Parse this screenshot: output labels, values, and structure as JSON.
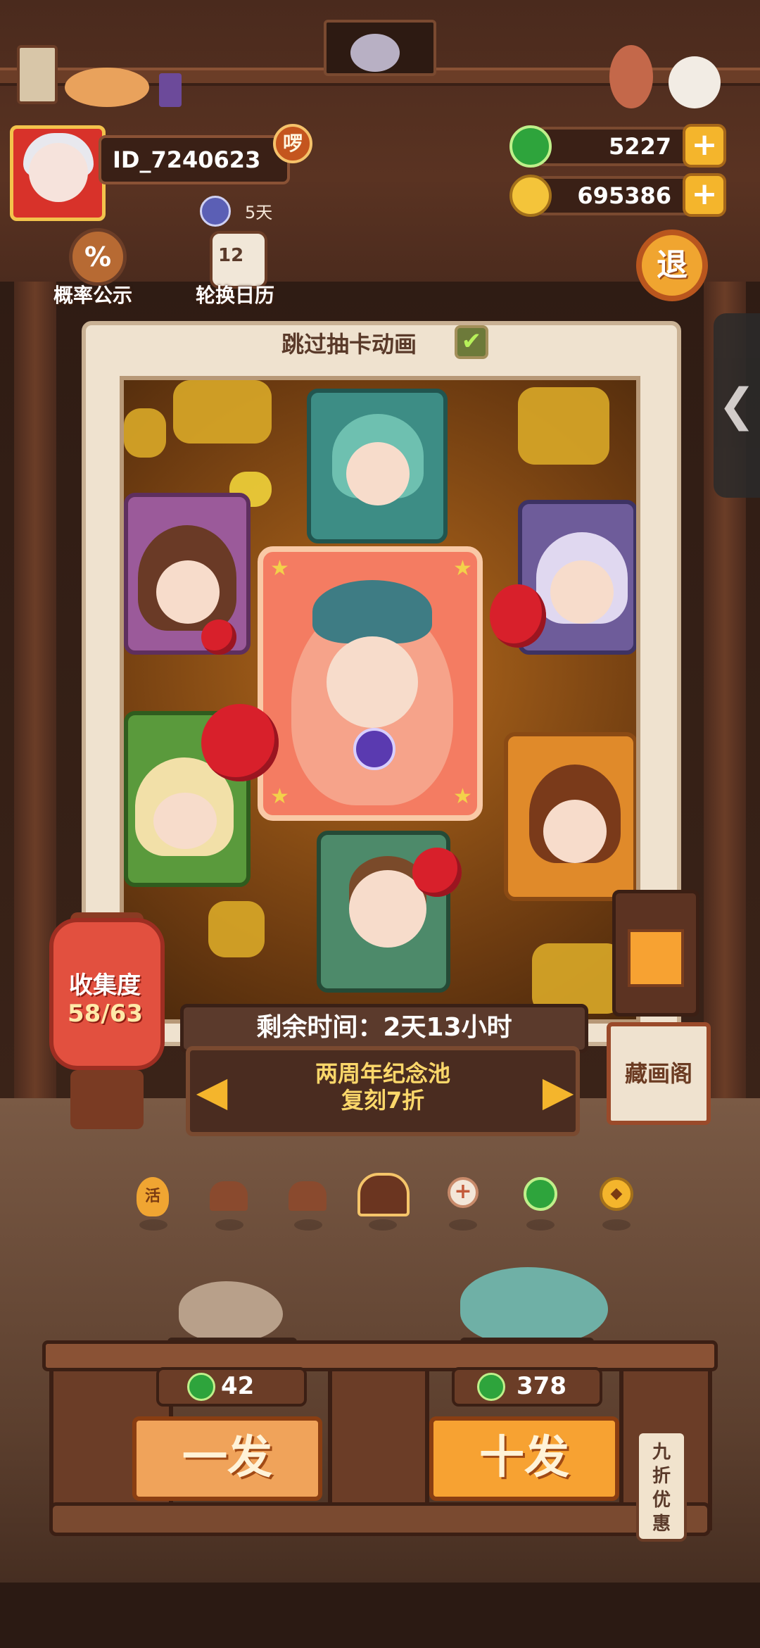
{
  "player": {
    "id": "ID_7240623",
    "badge": "啰",
    "vip_days": "5天"
  },
  "currencies": {
    "jade": "5227",
    "coins": "695386",
    "plus": "+"
  },
  "top_buttons": {
    "probability": "概率公示",
    "probability_icon": "%",
    "calendar": "轮换日历",
    "calendar_icon": "12",
    "quit": "退"
  },
  "side_tab": {
    "arrow": "❮"
  },
  "panel": {
    "skip_label": "跳过抽卡动画",
    "skip_checked": "✔"
  },
  "collection": {
    "label": "收集度",
    "progress": "58/63"
  },
  "gallery_sign": "藏画阁",
  "timer": "剩余时间：2天13小时",
  "pool": {
    "line1": "两周年纪念池",
    "line2": "复刻7折",
    "prev_arrow": "◀",
    "next_arrow": "▶"
  },
  "selector_icons": [
    {
      "name": "lantern-charm-icon",
      "glyph": "活"
    },
    {
      "name": "house-icon",
      "glyph": ""
    },
    {
      "name": "house-icon",
      "glyph": ""
    },
    {
      "name": "house-selected-icon",
      "glyph": ""
    },
    {
      "name": "plus-circle-icon",
      "glyph": "+"
    },
    {
      "name": "jade-icon",
      "glyph": ""
    },
    {
      "name": "coin-icon",
      "glyph": "◆"
    }
  ],
  "draw": {
    "single_cost": "42",
    "single_label": "一发",
    "ten_cost": "378",
    "ten_label": "十发",
    "discount": "九折优惠"
  },
  "colors": {
    "accent_orange": "#f7a232",
    "jade_green": "#2ea43c",
    "gold": "#f4b52c",
    "lantern_red": "#e2503f"
  }
}
